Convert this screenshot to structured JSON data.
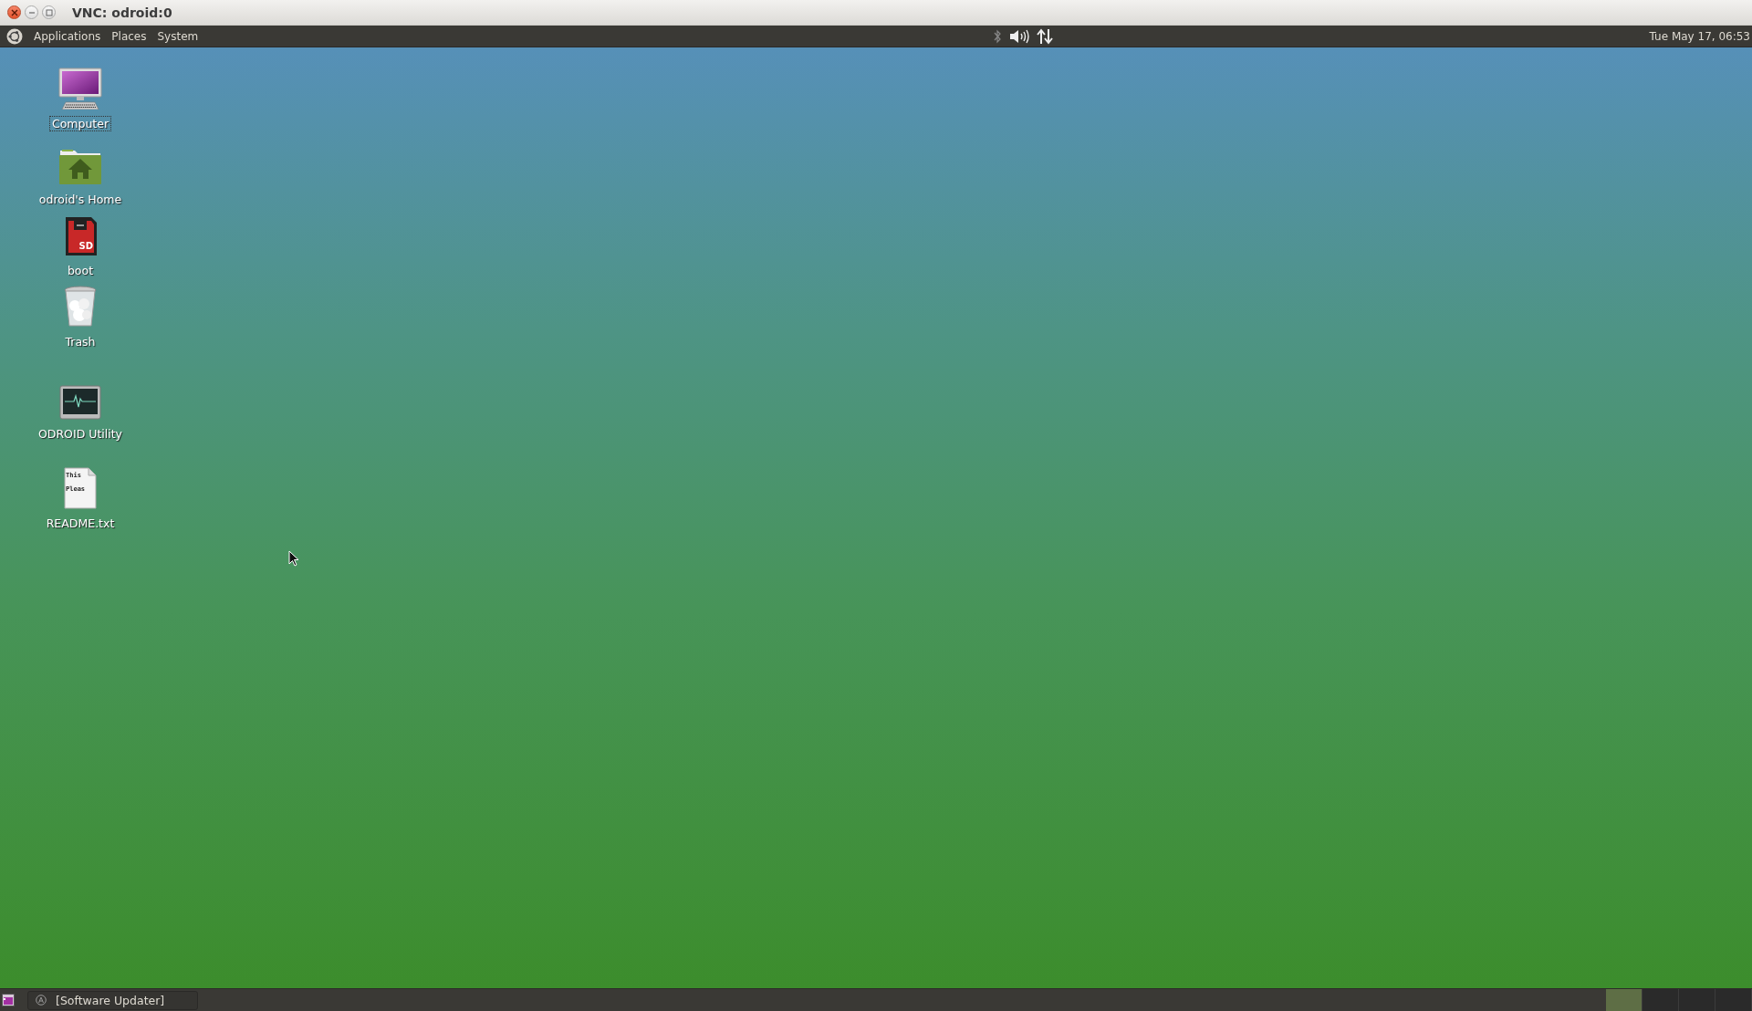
{
  "window": {
    "title": "VNC: odroid:0"
  },
  "top_panel": {
    "menus": [
      "Applications",
      "Places",
      "System"
    ],
    "clock": "Tue May 17, 06:53"
  },
  "desktop_icons": [
    {
      "kind": "computer",
      "label": "Computer",
      "selected": true
    },
    {
      "kind": "home",
      "label": "odroid's Home",
      "selected": false
    },
    {
      "kind": "sdcard",
      "label": "boot",
      "selected": false,
      "badge": "SD"
    },
    {
      "kind": "trash",
      "label": "Trash",
      "selected": false
    },
    {
      "kind": "monitor",
      "label": "ODROID Utility",
      "selected": false
    },
    {
      "kind": "textfile",
      "label": "README.txt",
      "selected": false,
      "preview_lines": [
        "This",
        "Pleas"
      ]
    }
  ],
  "bottom_panel": {
    "tasks": [
      {
        "label": "[Software Updater]"
      }
    ],
    "workspaces": [
      {
        "selected": true
      },
      {
        "selected": false
      },
      {
        "selected": false
      },
      {
        "selected": false
      }
    ]
  }
}
